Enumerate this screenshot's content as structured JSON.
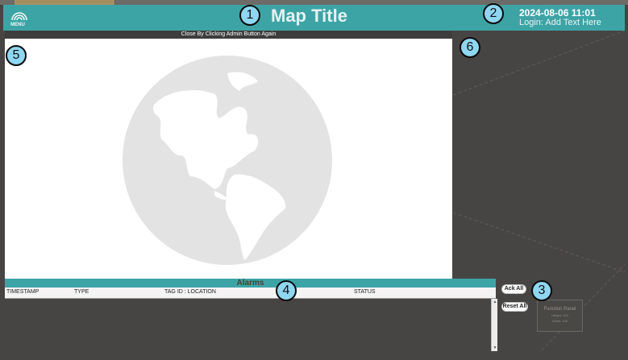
{
  "colors": {
    "header": "#3da4a6",
    "background": "#474543",
    "callout": "#8fd6f0",
    "globe": "#e3e3e3"
  },
  "header": {
    "menu_label": "MENU",
    "menu_icon": "logo-arcs-icon",
    "title": "Map Title",
    "datetime": "2024-08-06 11:01",
    "login": "Login: Add Text Here"
  },
  "admin_bar": {
    "text": "Close By Clicking Admin Button Again"
  },
  "map": {
    "icon": "globe-americas-icon"
  },
  "alarms": {
    "title": "Alarms",
    "columns": [
      "TIMESTAMP",
      "TYPE",
      "TAG ID : LOCATION",
      "STATUS"
    ],
    "rows": []
  },
  "buttons": {
    "ack_all": "Ack All",
    "reset_all": "Reset All"
  },
  "function_panel": {
    "title": "Function Panel",
    "height": "Height: 100",
    "width": "Width: 100"
  },
  "callouts": [
    "1",
    "2",
    "3",
    "4",
    "5",
    "6"
  ]
}
